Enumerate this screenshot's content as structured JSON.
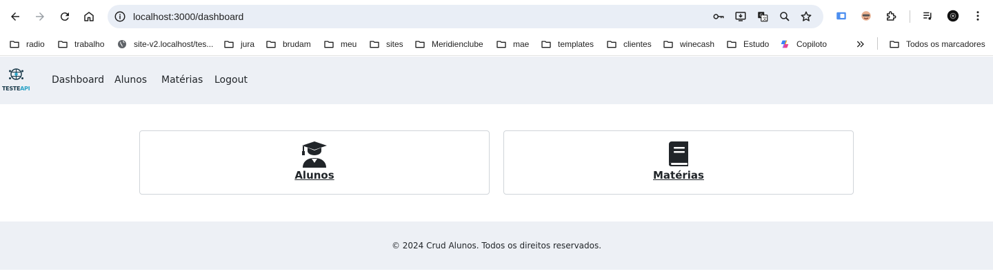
{
  "browser": {
    "url": "localhost:3000/dashboard",
    "icons": {
      "back": "back-arrow-icon",
      "forward": "forward-arrow-icon",
      "reload": "reload-icon",
      "home": "home-icon",
      "site_info": "site-info-icon",
      "password": "key-icon",
      "install": "install-app-icon",
      "translate": "translate-icon",
      "zoom": "zoom-icon",
      "bookmark": "star-icon",
      "extensions": "puzzle-icon",
      "media": "media-control-icon",
      "profile": "avatar",
      "menu": "kebab-menu-icon"
    }
  },
  "bookmarks": [
    {
      "label": "radio",
      "icon": "folder-icon"
    },
    {
      "label": "trabalho",
      "icon": "folder-icon"
    },
    {
      "label": "site-v2.localhost/tes...",
      "icon": "globe-icon"
    },
    {
      "label": "jura",
      "icon": "folder-icon"
    },
    {
      "label": "brudam",
      "icon": "folder-icon"
    },
    {
      "label": "meu",
      "icon": "folder-icon"
    },
    {
      "label": "sites",
      "icon": "folder-icon"
    },
    {
      "label": "Meridienclube",
      "icon": "folder-icon"
    },
    {
      "label": "mae",
      "icon": "folder-icon"
    },
    {
      "label": "templates",
      "icon": "folder-icon"
    },
    {
      "label": "clientes",
      "icon": "folder-icon"
    },
    {
      "label": "winecash",
      "icon": "folder-icon"
    },
    {
      "label": "Estudo",
      "icon": "folder-icon"
    },
    {
      "label": "Copiloto",
      "icon": "copilot-icon"
    }
  ],
  "bookmarks_all": "Todos os marcadores",
  "app": {
    "logo": {
      "text_main": "TESTE",
      "text_accent": "API"
    },
    "nav": [
      "Dashboard",
      "Alunos",
      "Matérias",
      "Logout"
    ],
    "cards": [
      {
        "title": "Alunos",
        "icon": "graduate-icon"
      },
      {
        "title": "Matérias",
        "icon": "book-icon"
      }
    ],
    "footer": "© 2024 Crud Alunos. Todos os direitos reservados."
  },
  "colors": {
    "omnibox_bg": "#e9eef6",
    "navbar_bg": "#edf0f5",
    "logo_accent": "#2aa3c7"
  }
}
